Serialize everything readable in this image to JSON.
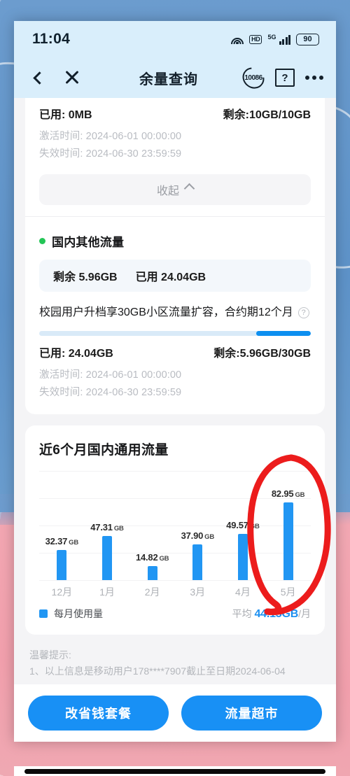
{
  "statusbar": {
    "time": "11:04",
    "wifi_icon": "wifi-icon",
    "hd_label": "HD",
    "network_label": "5G",
    "battery_level": "90"
  },
  "header": {
    "back_icon": "back-chevron-icon",
    "close_icon": "close-icon",
    "title": "余量查询",
    "service_number": "10086",
    "help_icon": "help-book-icon",
    "help_glyph": "?",
    "more_icon": "more-options-icon"
  },
  "package_top": {
    "used_label": "已用: 0MB",
    "remaining_label": "剩余:10GB/10GB",
    "activate_time": "激活时间: 2024-06-01 00:00:00",
    "expire_time": "失效时间: 2024-06-30 23:59:59",
    "collapse_label": "收起"
  },
  "other_traffic": {
    "section_title": "国内其他流量",
    "status_dot_color": "#23c556",
    "chip_remaining": "剩余 5.96GB",
    "chip_used": "已用 24.04GB",
    "description": "校园用户升档享30GB小区流量扩容，合约期12个月",
    "info_glyph": "?",
    "progress_percent": 20,
    "used_label": "已用: 24.04GB",
    "remaining_label": "剩余:5.96GB/30GB",
    "activate_time": "激活时间: 2024-06-01 00:00:00",
    "expire_time": "失效时间: 2024-06-30 23:59:59"
  },
  "chart_card": {
    "legend_label": "每月使用量",
    "legend_color": "#2196f3",
    "average_prefix": "平均",
    "average_value": "44.15GB",
    "average_suffix": "/月",
    "annotation": "red-hand-drawn-circle"
  },
  "chart_data": {
    "type": "bar",
    "title": "近6个月国内通用流量",
    "xlabel": "",
    "ylabel": "",
    "unit": "GB",
    "categories": [
      "12月",
      "1月",
      "2月",
      "3月",
      "4月",
      "5月"
    ],
    "values": [
      32.37,
      47.31,
      14.82,
      37.9,
      49.57,
      82.95
    ],
    "value_labels": [
      "32.37",
      "47.31",
      "14.82",
      "37.90",
      "49.57",
      "82.95"
    ],
    "ylim": [
      0,
      95
    ],
    "grid": true,
    "legend": [
      "每月使用量"
    ],
    "legend_position": "bottom-left",
    "annotation_note": "平均 44.15GB/月"
  },
  "tips": {
    "heading": "温馨提示:",
    "line1": "1、以上信息是移动用户178****7907截止至日期2024-06-04"
  },
  "actions": {
    "primary_label": "改省钱套餐",
    "secondary_label": "流量超市",
    "accent_color": "#1890f5"
  }
}
